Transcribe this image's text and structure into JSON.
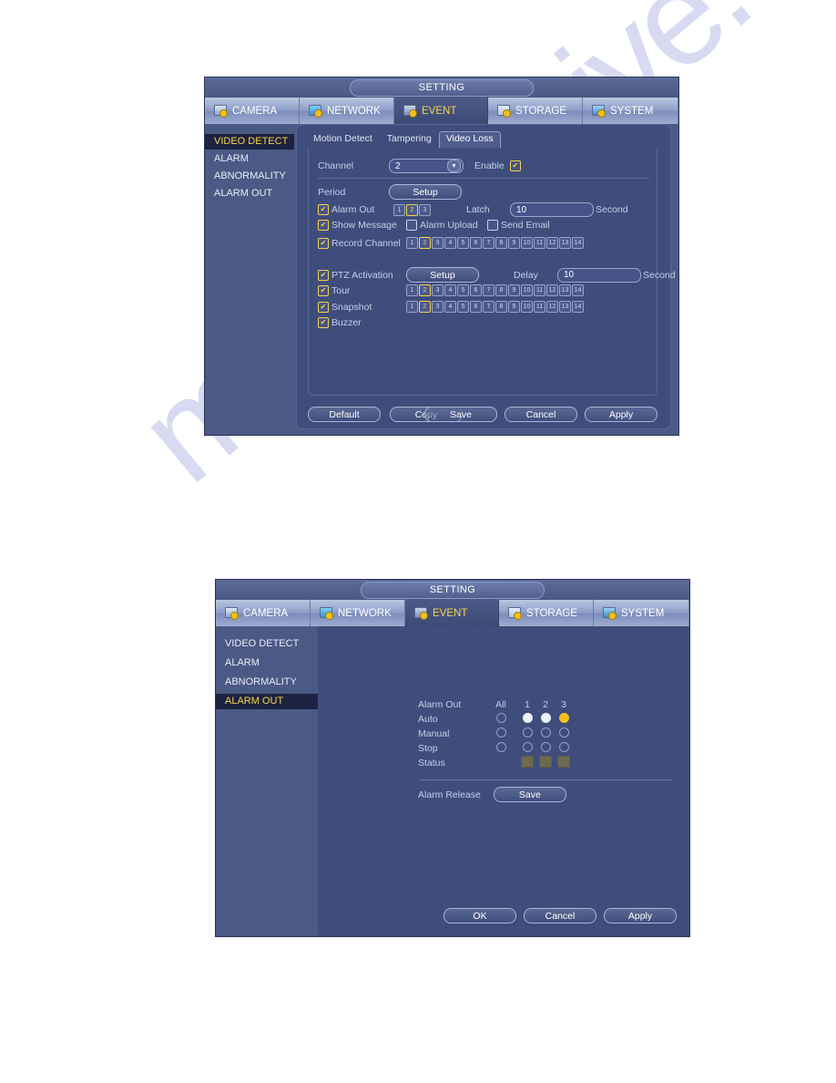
{
  "watermark": "manualshive.com",
  "panel_video_loss": {
    "title": "SETTING",
    "tabs": [
      {
        "label": "CAMERA",
        "icon": "camera-icon",
        "active": false
      },
      {
        "label": "NETWORK",
        "icon": "network-icon",
        "active": false
      },
      {
        "label": "EVENT",
        "icon": "event-icon",
        "active": true
      },
      {
        "label": "STORAGE",
        "icon": "storage-icon",
        "active": false
      },
      {
        "label": "SYSTEM",
        "icon": "system-icon",
        "active": false
      }
    ],
    "sidebar": [
      {
        "label": "VIDEO DETECT",
        "active": true
      },
      {
        "label": "ALARM",
        "active": false
      },
      {
        "label": "ABNORMALITY",
        "active": false
      },
      {
        "label": "ALARM OUT",
        "active": false
      }
    ],
    "subtabs": [
      {
        "label": "Motion Detect",
        "active": false
      },
      {
        "label": "Tampering",
        "active": false
      },
      {
        "label": "Video Loss",
        "active": true
      }
    ],
    "channel_label": "Channel",
    "channel_value": "2",
    "enable_label": "Enable",
    "enable_checked": true,
    "period_label": "Period",
    "period_button": "Setup",
    "alarm_out_label": "Alarm Out",
    "alarm_out_checked": true,
    "alarm_out_channels": [
      {
        "n": "1",
        "sel": false
      },
      {
        "n": "2",
        "sel": true
      },
      {
        "n": "3",
        "sel": false
      }
    ],
    "latch_label": "Latch",
    "latch_value": "10",
    "latch_unit": "Second",
    "show_message_label": "Show Message",
    "show_message_checked": true,
    "alarm_upload_label": "Alarm Upload",
    "alarm_upload_checked": false,
    "send_email_label": "Send Email",
    "send_email_checked": false,
    "record_channel_label": "Record Channel",
    "record_channel_checked": true,
    "record_channels": [
      {
        "n": "1",
        "sel": false
      },
      {
        "n": "2",
        "sel": true
      },
      {
        "n": "3",
        "sel": false
      },
      {
        "n": "4",
        "sel": false
      },
      {
        "n": "5",
        "sel": false
      },
      {
        "n": "6",
        "sel": false
      },
      {
        "n": "7",
        "sel": false
      },
      {
        "n": "8",
        "sel": false
      },
      {
        "n": "9",
        "sel": false
      },
      {
        "n": "10",
        "sel": false
      },
      {
        "n": "11",
        "sel": false
      },
      {
        "n": "12",
        "sel": false
      },
      {
        "n": "13",
        "sel": false
      },
      {
        "n": "14",
        "sel": false
      }
    ],
    "ptz_label": "PTZ Activation",
    "ptz_checked": true,
    "ptz_button": "Setup",
    "delay_label": "Delay",
    "delay_value": "10",
    "delay_unit": "Second",
    "tour_label": "Tour",
    "tour_checked": true,
    "tour_channels": [
      {
        "n": "1",
        "sel": false
      },
      {
        "n": "2",
        "sel": true
      },
      {
        "n": "3",
        "sel": false
      },
      {
        "n": "4",
        "sel": false
      },
      {
        "n": "5",
        "sel": false
      },
      {
        "n": "6",
        "sel": false
      },
      {
        "n": "7",
        "sel": false
      },
      {
        "n": "8",
        "sel": false
      },
      {
        "n": "9",
        "sel": false
      },
      {
        "n": "10",
        "sel": false
      },
      {
        "n": "11",
        "sel": false
      },
      {
        "n": "12",
        "sel": false
      },
      {
        "n": "13",
        "sel": false
      },
      {
        "n": "14",
        "sel": false
      }
    ],
    "snapshot_label": "Snapshot",
    "snapshot_checked": true,
    "snapshot_channels": [
      {
        "n": "1",
        "sel": false
      },
      {
        "n": "2",
        "sel": true
      },
      {
        "n": "3",
        "sel": false
      },
      {
        "n": "4",
        "sel": false
      },
      {
        "n": "5",
        "sel": false
      },
      {
        "n": "6",
        "sel": false
      },
      {
        "n": "7",
        "sel": false
      },
      {
        "n": "8",
        "sel": false
      },
      {
        "n": "9",
        "sel": false
      },
      {
        "n": "10",
        "sel": false
      },
      {
        "n": "11",
        "sel": false
      },
      {
        "n": "12",
        "sel": false
      },
      {
        "n": "13",
        "sel": false
      },
      {
        "n": "14",
        "sel": false
      }
    ],
    "buzzer_label": "Buzzer",
    "buzzer_checked": true,
    "buttons": {
      "default": "Default",
      "copy": "Copy",
      "save": "Save",
      "cancel": "Cancel",
      "apply": "Apply"
    }
  },
  "panel_alarm_out": {
    "title": "SETTING",
    "tabs": [
      {
        "label": "CAMERA",
        "icon": "camera-icon",
        "active": false
      },
      {
        "label": "NETWORK",
        "icon": "network-icon",
        "active": false
      },
      {
        "label": "EVENT",
        "icon": "event-icon",
        "active": true
      },
      {
        "label": "STORAGE",
        "icon": "storage-icon",
        "active": false
      },
      {
        "label": "SYSTEM",
        "icon": "system-icon",
        "active": false
      }
    ],
    "sidebar": [
      {
        "label": "VIDEO DETECT",
        "active": false
      },
      {
        "label": "ALARM",
        "active": false
      },
      {
        "label": "ABNORMALITY",
        "active": false
      },
      {
        "label": "ALARM OUT",
        "active": true
      }
    ],
    "header": {
      "row_label": "Alarm Out",
      "all_label": "All",
      "channels": [
        "1",
        "2",
        "3"
      ]
    },
    "rows": [
      {
        "label": "Auto",
        "all": false,
        "states": [
          "on",
          "on",
          "amber"
        ]
      },
      {
        "label": "Manual",
        "all": false,
        "states": [
          "off",
          "off",
          "off"
        ]
      },
      {
        "label": "Stop",
        "all": false,
        "states": [
          "off",
          "off",
          "off"
        ]
      }
    ],
    "status_label": "Status",
    "status_boxes": 3,
    "alarm_release_label": "Alarm Release",
    "alarm_release_button": "Save",
    "buttons": {
      "ok": "OK",
      "cancel": "Cancel",
      "apply": "Apply"
    }
  }
}
